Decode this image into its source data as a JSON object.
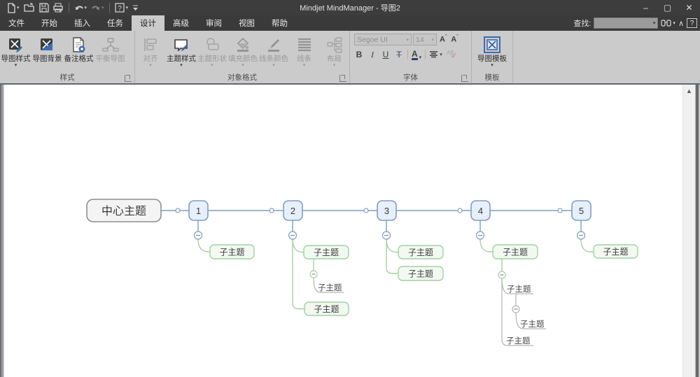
{
  "window": {
    "title": "Mindjet MindManager - 导图2",
    "minimize": "–",
    "maximize": "▢",
    "close": "✕"
  },
  "tabs": {
    "items": [
      "文件",
      "开始",
      "插入",
      "任务",
      "设计",
      "高级",
      "审阅",
      "视图",
      "帮助"
    ],
    "active": "设计"
  },
  "find": {
    "label": "查找:",
    "value": "",
    "collapse_glyph": "∧",
    "help_glyph": "?"
  },
  "ribbon": {
    "groups": {
      "style": {
        "label": "样式",
        "buttons": [
          {
            "label": "导图样式",
            "enabled": true,
            "dropdown": true
          },
          {
            "label": "导图背景",
            "enabled": true,
            "dropdown": false
          },
          {
            "label": "备注格式",
            "enabled": true,
            "dropdown": false
          },
          {
            "label": "平衡导图",
            "enabled": false,
            "dropdown": false
          }
        ]
      },
      "object_format": {
        "label": "对象格式",
        "buttons": [
          {
            "label": "对齐",
            "enabled": false,
            "dropdown": true
          },
          {
            "label": "主题样式",
            "enabled": true,
            "dropdown": true
          },
          {
            "label": "主题形状",
            "enabled": false,
            "dropdown": true
          },
          {
            "label": "填充颜色",
            "enabled": false,
            "dropdown": true
          },
          {
            "label": "线条颜色",
            "enabled": false,
            "dropdown": true
          },
          {
            "label": "线条",
            "enabled": false,
            "dropdown": true
          },
          {
            "label": "布局",
            "enabled": false,
            "dropdown": true
          }
        ]
      },
      "font": {
        "label": "字体",
        "font_name": "Segoe UI",
        "font_size": "14",
        "bold": "B",
        "italic": "I",
        "underline": "U",
        "strikethrough": "T",
        "font_color_glyph": "A"
      },
      "template": {
        "label": "模板",
        "button": "导图模板"
      }
    }
  },
  "mindmap": {
    "central": "中心主题",
    "subtopic_label": "子主题",
    "colors": {
      "blue": "#7e9dc4",
      "green": "#a4d0a4",
      "gray": "#b3b3b3",
      "blue_fill": "#e7effa",
      "green_fill": "#f1f9f1",
      "central_fill": "#f4f4f4"
    },
    "topics": [
      {
        "label": "1",
        "children": [
          {
            "label": "子主题",
            "type": "box"
          }
        ]
      },
      {
        "label": "2",
        "children": [
          {
            "label": "子主题",
            "type": "box",
            "children": [
              {
                "label": "子主题",
                "type": "line"
              }
            ]
          },
          {
            "label": "子主题",
            "type": "box"
          }
        ]
      },
      {
        "label": "3",
        "children": [
          {
            "label": "子主题",
            "type": "box"
          },
          {
            "label": "子主题",
            "type": "box"
          }
        ]
      },
      {
        "label": "4",
        "children": [
          {
            "label": "子主题",
            "type": "box",
            "children": [
              {
                "label": "子主题",
                "type": "line",
                "children": [
                  {
                    "label": "子主题",
                    "type": "line"
                  }
                ]
              },
              {
                "label": "子主题",
                "type": "line"
              }
            ]
          }
        ]
      },
      {
        "label": "5",
        "children": [
          {
            "label": "子主题",
            "type": "box"
          }
        ]
      }
    ]
  }
}
